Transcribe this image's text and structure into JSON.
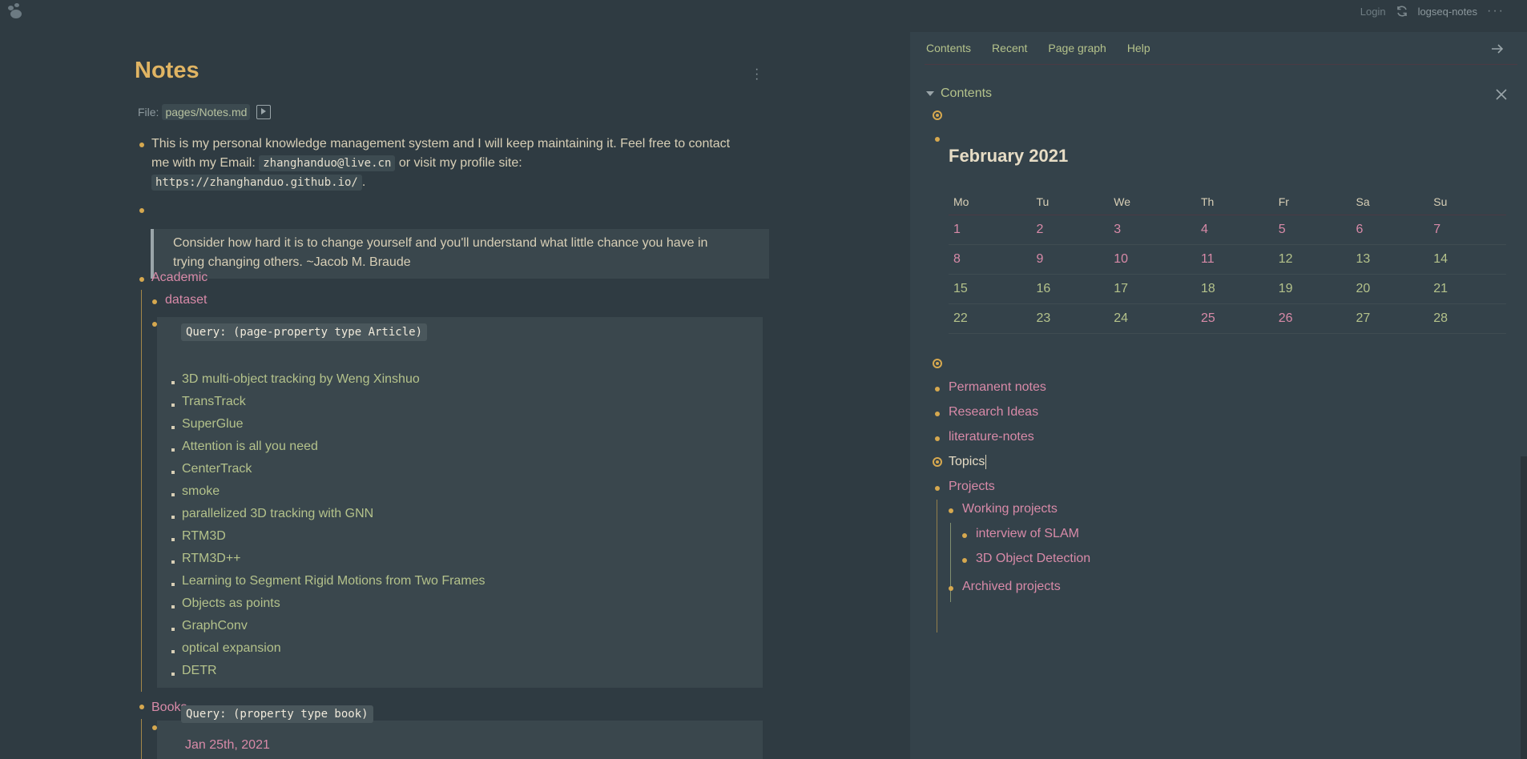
{
  "topbar": {
    "login": "Login",
    "repo": "logseq-notes",
    "more": "···"
  },
  "page": {
    "title": "Notes",
    "file_label": "File:",
    "file_path": "pages/Notes.md",
    "intro": {
      "part1": "This is my personal knowledge management system and I will keep maintaining it. Feel free to contact",
      "part2": "me with my Email:",
      "email": "zhanghanduo@live.cn",
      "part3": "or visit my profile site:",
      "site": "https://zhanghanduo.github.io/",
      "end": "."
    },
    "quote_line1": "Consider how hard it is to change yourself and you'll understand what little chance you have in",
    "quote_line2": "trying changing others. ~Jacob M. Braude",
    "academic": "Academic",
    "dataset": "dataset",
    "query1": "Query: (page-property type Article)",
    "articles": [
      "3D multi-object tracking by Weng Xinshuo",
      "TransTrack",
      "SuperGlue",
      "Attention is all you need",
      "CenterTrack",
      "smoke",
      "parallelized 3D tracking with GNN",
      "RTM3D",
      "RTM3D++",
      "Learning to Segment Rigid Motions from Two Frames",
      "Objects as points",
      "GraphConv",
      "optical expansion",
      "DETR"
    ],
    "books": "Books",
    "query2": "Query: (property type book)",
    "query2_date": "Jan 25th, 2021"
  },
  "sidebar": {
    "tabs": [
      "Contents",
      "Recent",
      "Page graph",
      "Help"
    ],
    "contents_title": "Contents",
    "calendar": {
      "title": "February 2021",
      "days": [
        "Mo",
        "Tu",
        "We",
        "Th",
        "Fr",
        "Sa",
        "Su"
      ],
      "weeks": [
        [
          "1",
          "2",
          "3",
          "4",
          "5",
          "6",
          "7"
        ],
        [
          "8",
          "9",
          "10",
          "11",
          "12",
          "13",
          "14"
        ],
        [
          "15",
          "16",
          "17",
          "18",
          "19",
          "20",
          "21"
        ],
        [
          "22",
          "23",
          "24",
          "25",
          "26",
          "27",
          "28"
        ]
      ]
    },
    "items": {
      "permanent": "Permanent notes",
      "research": "Research Ideas",
      "literature": "literature-notes",
      "topics": "Topics",
      "projects": "Projects",
      "working": "Working projects",
      "slam": "interview of SLAM",
      "detection": "3D Object Detection",
      "archived": "Archived projects"
    }
  },
  "colors": {
    "accent_gold": "#d6a84f",
    "link_pink": "#d88aa8",
    "link_green": "#b4c28b",
    "background": "#2f3b42"
  }
}
